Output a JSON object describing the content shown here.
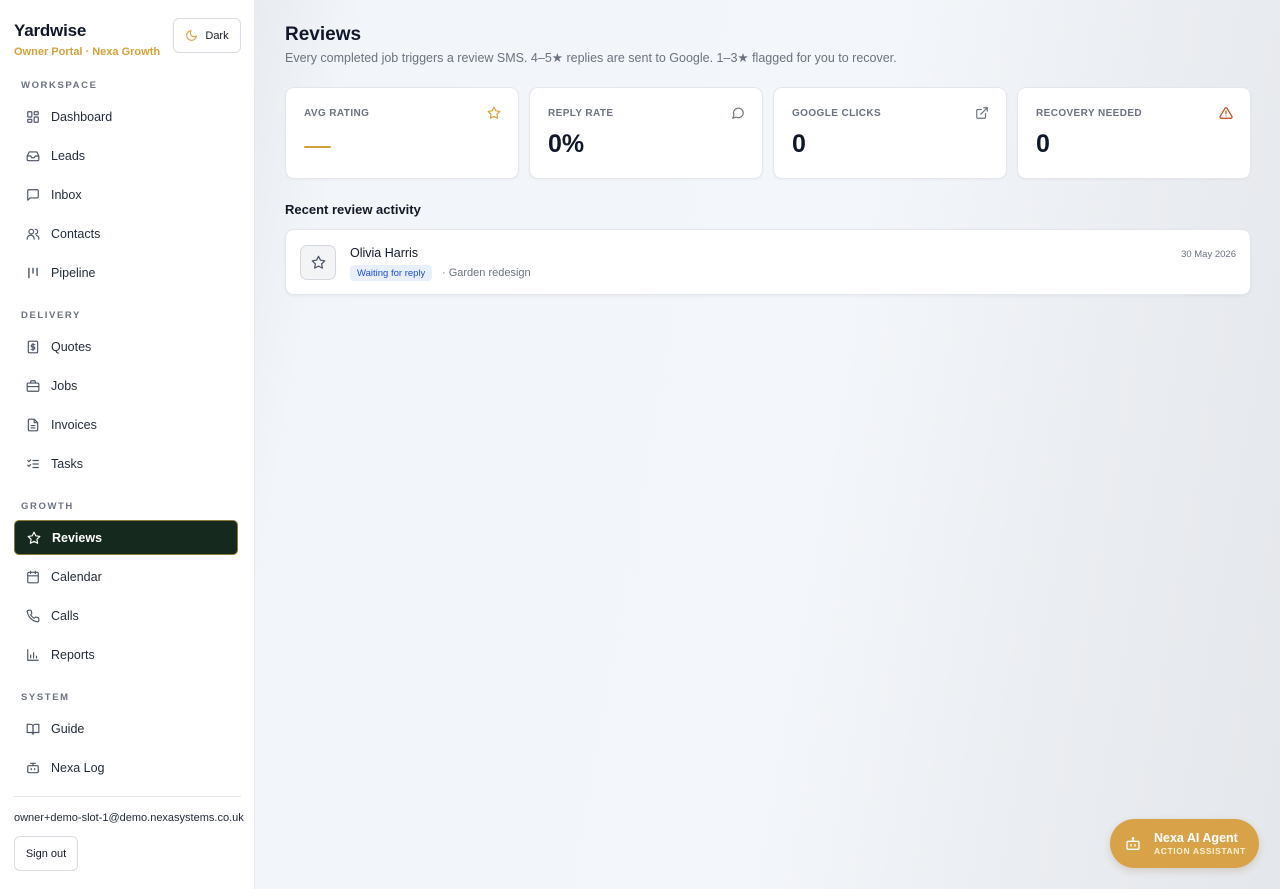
{
  "brand": {
    "name": "Yardwise",
    "subtitle": "Owner Portal · Nexa Growth"
  },
  "theme_toggle": {
    "label": "Dark",
    "icon": "moon-icon"
  },
  "sidebar": {
    "sections": [
      {
        "label": "WORKSPACE",
        "items": [
          {
            "label": "Dashboard",
            "icon": "dashboard-icon"
          },
          {
            "label": "Leads",
            "icon": "inbox-tray-icon"
          },
          {
            "label": "Inbox",
            "icon": "chat-bubble-icon"
          },
          {
            "label": "Contacts",
            "icon": "users-icon"
          },
          {
            "label": "Pipeline",
            "icon": "pipeline-icon"
          }
        ]
      },
      {
        "label": "DELIVERY",
        "items": [
          {
            "label": "Quotes",
            "icon": "dollar-doc-icon"
          },
          {
            "label": "Jobs",
            "icon": "briefcase-icon"
          },
          {
            "label": "Invoices",
            "icon": "file-text-icon"
          },
          {
            "label": "Tasks",
            "icon": "checklist-icon"
          }
        ]
      },
      {
        "label": "GROWTH",
        "items": [
          {
            "label": "Reviews",
            "icon": "star-icon",
            "active": true
          },
          {
            "label": "Calendar",
            "icon": "calendar-icon"
          },
          {
            "label": "Calls",
            "icon": "phone-icon"
          },
          {
            "label": "Reports",
            "icon": "bar-chart-icon"
          }
        ]
      },
      {
        "label": "SYSTEM",
        "items": [
          {
            "label": "Guide",
            "icon": "book-icon"
          },
          {
            "label": "Nexa Log",
            "icon": "bot-icon"
          }
        ]
      }
    ],
    "user_email": "owner+demo-slot-1@demo.nexasystems.co.uk",
    "sign_out": "Sign out"
  },
  "page": {
    "title": "Reviews",
    "subtitle": "Every completed job triggers a review SMS. 4–5★ replies are sent to Google. 1–3★ flagged for you to recover."
  },
  "stats": [
    {
      "label": "AVG RATING",
      "value": "",
      "icon": "star-icon",
      "icon_color": "#d4a23c"
    },
    {
      "label": "REPLY RATE",
      "value": "0%",
      "icon": "chat-bubble-icon",
      "icon_color": "#6b7280"
    },
    {
      "label": "GOOGLE CLICKS",
      "value": "0",
      "icon": "external-link-icon",
      "icon_color": "#6b7280"
    },
    {
      "label": "RECOVERY NEEDED",
      "value": "0",
      "icon": "warning-icon",
      "icon_color": "#c2410c"
    }
  ],
  "activity": {
    "heading": "Recent review activity",
    "items": [
      {
        "name": "Olivia Harris",
        "status": "Waiting for reply",
        "service": "· Garden redesign",
        "date": "30 May 2026"
      }
    ]
  },
  "agent": {
    "title": "Nexa AI Agent",
    "subtitle": "ACTION ASSISTANT",
    "icon": "bot-icon"
  },
  "colors": {
    "accent": "#d4a23c",
    "active_nav": "#16291e",
    "badge_bg": "#e8efff",
    "badge_text": "#1d4ed8"
  }
}
